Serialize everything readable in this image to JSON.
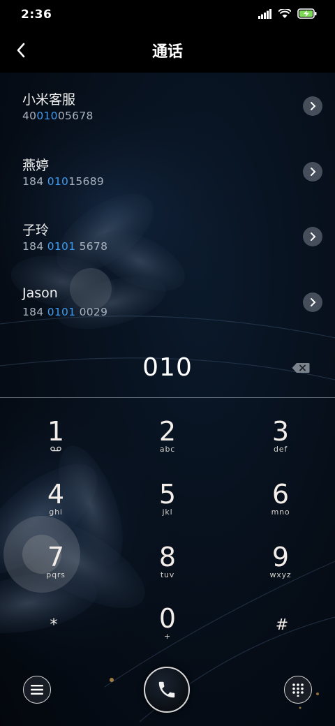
{
  "status_bar": {
    "time": "2:36",
    "icons": [
      "signal-icon",
      "wifi-icon",
      "battery-charging-icon"
    ]
  },
  "header": {
    "title": "通话",
    "back_icon": "back-chevron-icon"
  },
  "contacts": [
    {
      "name": "小米客服",
      "number_pre": "40",
      "number_hl": "010",
      "number_post": "05678"
    },
    {
      "name": "燕婷",
      "number_pre": "184 ",
      "number_hl": "010",
      "number_post": "15689"
    },
    {
      "name": "子玲",
      "number_pre": "184 ",
      "number_hl": "0101",
      "number_post": " 5678"
    },
    {
      "name": "Jason",
      "number_pre": "184 ",
      "number_hl": "0101",
      "number_post": " 0029"
    }
  ],
  "input": {
    "digits": "010"
  },
  "keypad": [
    {
      "num": "1",
      "letters": ""
    },
    {
      "num": "2",
      "letters": "abc"
    },
    {
      "num": "3",
      "letters": "def"
    },
    {
      "num": "4",
      "letters": "ghi"
    },
    {
      "num": "5",
      "letters": "jkl"
    },
    {
      "num": "6",
      "letters": "mno"
    },
    {
      "num": "7",
      "letters": "pqrs"
    },
    {
      "num": "8",
      "letters": "tuv"
    },
    {
      "num": "9",
      "letters": "wxyz"
    },
    {
      "num": "*",
      "letters": ""
    },
    {
      "num": "0",
      "letters": "+"
    },
    {
      "num": "#",
      "letters": ""
    }
  ],
  "colors": {
    "highlight": "#3d9bef",
    "background": "#000000",
    "secondary_text": "#a9b3bf"
  }
}
